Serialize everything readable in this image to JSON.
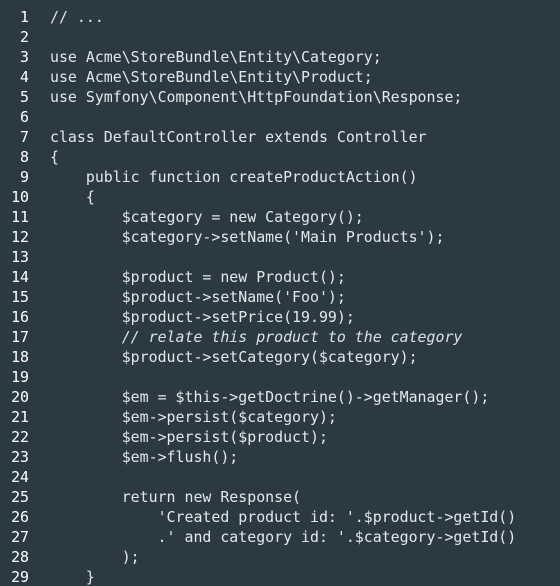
{
  "editor": {
    "lines": [
      {
        "number": "1",
        "text": "// ..."
      },
      {
        "number": "2",
        "text": ""
      },
      {
        "number": "3",
        "text": "use Acme\\StoreBundle\\Entity\\Category;"
      },
      {
        "number": "4",
        "text": "use Acme\\StoreBundle\\Entity\\Product;"
      },
      {
        "number": "5",
        "text": "use Symfony\\Component\\HttpFoundation\\Response;"
      },
      {
        "number": "6",
        "text": ""
      },
      {
        "number": "7",
        "text": "class DefaultController extends Controller"
      },
      {
        "number": "8",
        "text": "{"
      },
      {
        "number": "9",
        "text": "    public function createProductAction()"
      },
      {
        "number": "10",
        "text": "    {"
      },
      {
        "number": "11",
        "text": "        $category = new Category();"
      },
      {
        "number": "12",
        "text": "        $category->setName('Main Products');"
      },
      {
        "number": "13",
        "text": ""
      },
      {
        "number": "14",
        "text": "        $product = new Product();"
      },
      {
        "number": "15",
        "text": "        $product->setName('Foo');"
      },
      {
        "number": "16",
        "text": "        $product->setPrice(19.99);"
      },
      {
        "number": "17",
        "text": "        // relate this product to the category"
      },
      {
        "number": "18",
        "text": "        $product->setCategory($category);"
      },
      {
        "number": "19",
        "text": ""
      },
      {
        "number": "20",
        "text": "        $em = $this->getDoctrine()->getManager();"
      },
      {
        "number": "21",
        "text": "        $em->persist($category);"
      },
      {
        "number": "22",
        "text": "        $em->persist($product);"
      },
      {
        "number": "23",
        "text": "        $em->flush();"
      },
      {
        "number": "24",
        "text": ""
      },
      {
        "number": "25",
        "text": "        return new Response("
      },
      {
        "number": "26",
        "text": "            'Created product id: '.$product->getId()"
      },
      {
        "number": "27",
        "text": "            .' and category id: '.$category->getId()"
      },
      {
        "number": "28",
        "text": "        );"
      },
      {
        "number": "29",
        "text": "    }"
      }
    ]
  }
}
